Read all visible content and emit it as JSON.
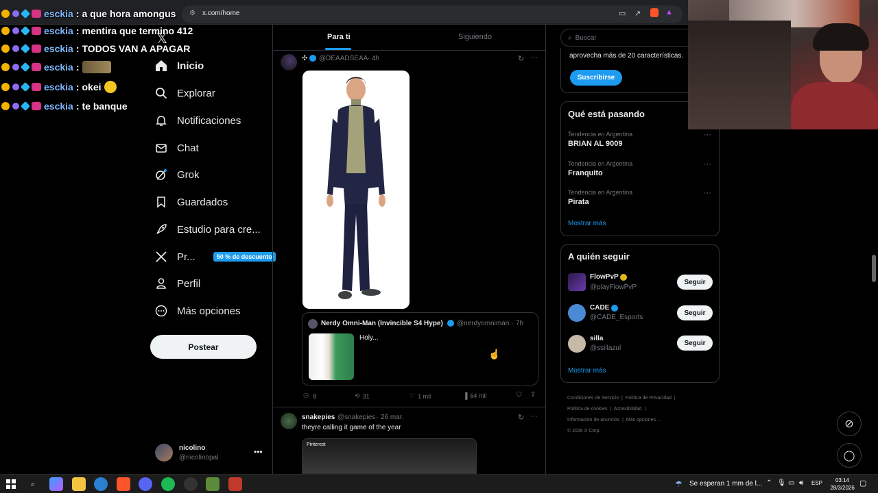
{
  "browser": {
    "url": "x.com/home"
  },
  "chat": [
    {
      "user": "esckia",
      "text": "a que hora amongus"
    },
    {
      "user": "esckia",
      "text": "mentira que termino 412"
    },
    {
      "user": "esckia",
      "text": "TODOS VAN A APAGAR"
    },
    {
      "user": "esckia",
      "text": ""
    },
    {
      "user": "esckia",
      "text": "okei"
    },
    {
      "user": "esckia",
      "text": "te banque"
    }
  ],
  "nav": {
    "items": [
      "Inicio",
      "Explorar",
      "Notificaciones",
      "Chat",
      "Grok",
      "Guardados",
      "Estudio para cre...",
      "Pr...",
      "Perfil",
      "Más opciones"
    ],
    "promo": "50 % de descuento",
    "post_button": "Postear"
  },
  "account": {
    "name": "nicolino",
    "handle": "@nicolinopal"
  },
  "tabs": {
    "for_you": "Para ti",
    "following": "Siguiendo"
  },
  "tweet1": {
    "handle": "@DEAADSEAA",
    "time": "4h",
    "quote": {
      "name": "Nerdy Omni-Man (Invincible S4 Hype)",
      "handle": "@nerdyomniman",
      "time": "7h",
      "text": "Holy..."
    },
    "stats": {
      "replies": "8",
      "reposts": "31",
      "likes": "1 mil",
      "views": "64 mil"
    }
  },
  "tweet2": {
    "name": "snakepies",
    "handle": "@snakepies",
    "time": "26 mar.",
    "text": "theyre calling it game of the year",
    "media_label": "Pinterest"
  },
  "search": {
    "placeholder": "Buscar"
  },
  "premium": {
    "text": "aprovecha más de 20 características.",
    "button": "Suscribirse"
  },
  "trends": {
    "title": "Qué está pasando",
    "items": [
      {
        "sub": "Tendencia en Argentina",
        "name": "BRIAN AL 9009"
      },
      {
        "sub": "Tendencia en Argentina",
        "name": "Franquito"
      },
      {
        "sub": "Tendencia en Argentina",
        "name": "Pirata"
      }
    ],
    "more": "Mostrar más"
  },
  "who_to_follow": {
    "title": "A quién seguir",
    "items": [
      {
        "name": "FlowPvP",
        "handle": "@playFlowPvP",
        "button": "Seguir"
      },
      {
        "name": "CADE",
        "handle": "@CADE_Esports",
        "button": "Seguir"
      },
      {
        "name": "silla",
        "handle": "@ssillazul",
        "button": "Seguir"
      }
    ],
    "more": "Mostrar más"
  },
  "footer": [
    "Condiciones de Servicio",
    "Política de Privacidad",
    "Política de cookies",
    "Accesibilidad",
    "Información de anuncios",
    "Más opciones ...",
    "© 2026 X Corp."
  ],
  "taskbar": {
    "weather": "Se esperan 1 mm de l...",
    "lang": "ESP",
    "time": "03:14",
    "date": "28/3/2026"
  },
  "colors": {
    "accent": "#1d9bf0",
    "background": "#000000",
    "border": "#2f3336"
  }
}
